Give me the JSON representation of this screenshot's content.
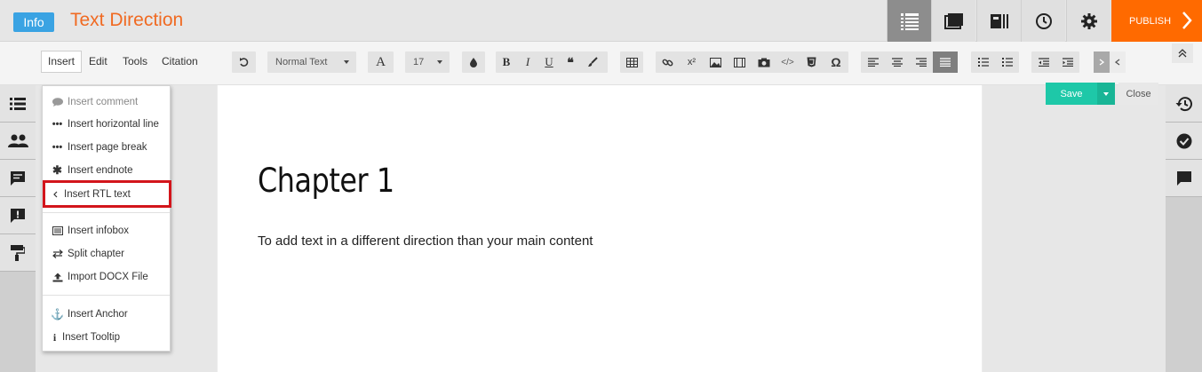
{
  "header": {
    "badge": "Info",
    "title": "Text Direction",
    "publish_label": "PUBLISH",
    "accent_color": "#f06a22",
    "publish_color": "#ff6a00"
  },
  "menus": [
    "Insert",
    "Edit",
    "Tools",
    "Citation"
  ],
  "toolbar": {
    "style_select": "Normal Text",
    "font_size": "17"
  },
  "editor": {
    "chapter_title": "Chapter 1",
    "body": "To add text in a different direction  than your main content"
  },
  "actions": {
    "save": "Save",
    "close": "Close",
    "save_color": "#1ec8a8"
  },
  "insert_menu": {
    "comment": "Insert comment",
    "hline": "Insert horizontal line",
    "pagebreak": "Insert page break",
    "endnote": "Insert endnote",
    "rtl": "Insert RTL text",
    "infobox": "Insert infobox",
    "split": "Split chapter",
    "docx": "Import DOCX File",
    "anchor": "Insert Anchor",
    "tooltip": "Insert Tooltip",
    "highlight_color": "#d3151b"
  }
}
